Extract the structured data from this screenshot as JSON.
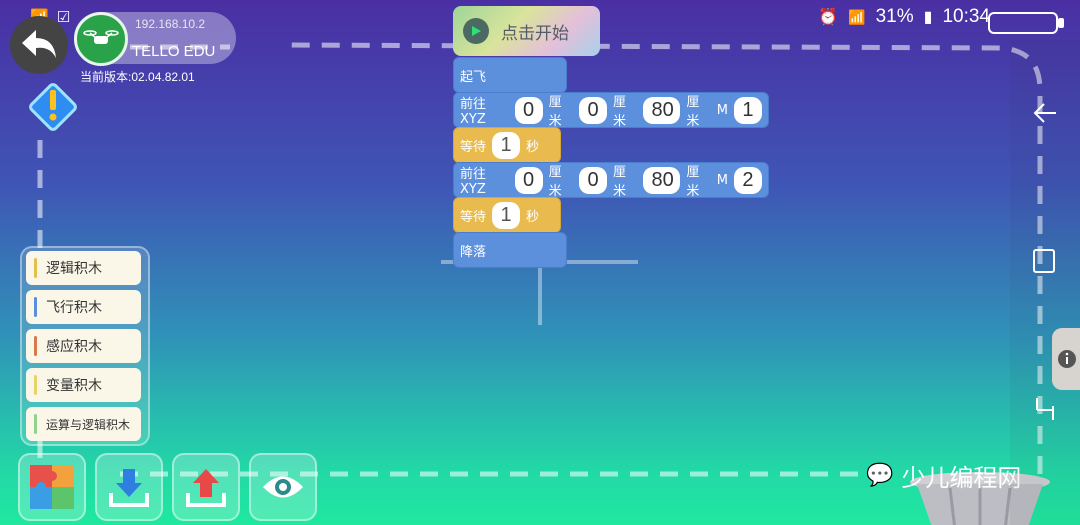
{
  "status_bar": {
    "battery_percent": "31%",
    "time": "10:34"
  },
  "device": {
    "ip": "192.168.10.2",
    "name": "TELLO EDU",
    "version": "当前版本:02.04.82.01"
  },
  "start_button": {
    "label": "点击开始"
  },
  "blocks": {
    "takeoff": "起飞",
    "goto1": {
      "label": "前往XYZ",
      "x": "0",
      "y": "0",
      "z": "80",
      "unit": "厘米",
      "m_label": "M",
      "m": "1"
    },
    "wait1": {
      "label": "等待",
      "value": "1",
      "unit": "秒"
    },
    "goto2": {
      "label": "前往XYZ",
      "x": "0",
      "y": "0",
      "z": "80",
      "unit": "厘米",
      "m_label": "M",
      "m": "2"
    },
    "wait2": {
      "label": "等待",
      "value": "1",
      "unit": "秒"
    },
    "land": "降落"
  },
  "categories": [
    {
      "label": "逻辑积木",
      "color": "#e3c04b"
    },
    {
      "label": "飞行积木",
      "color": "#5b8edc"
    },
    {
      "label": "感应积木",
      "color": "#d9784a"
    },
    {
      "label": "变量积木",
      "color": "#e6d36a"
    },
    {
      "label": "运算与逻辑积木",
      "color": "#8fd48a"
    }
  ],
  "toolbar": {
    "puzzle": "puzzle-icon",
    "download": "download-icon",
    "upload": "upload-icon",
    "view": "eye-icon"
  },
  "watermark": "少儿编程网"
}
